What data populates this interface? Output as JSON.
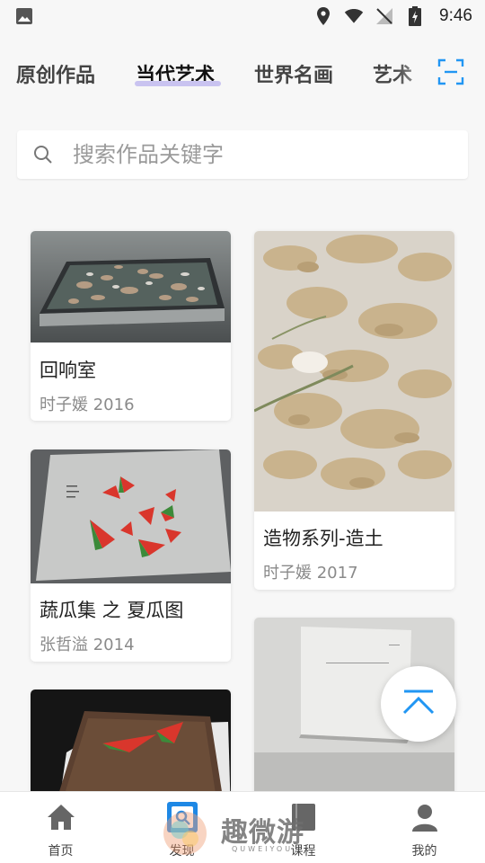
{
  "status_bar": {
    "time": "9:46"
  },
  "tabs": [
    {
      "label": "原创作品"
    },
    {
      "label": "当代艺术",
      "active": true
    },
    {
      "label": "世界名画"
    },
    {
      "label": "艺术"
    }
  ],
  "search": {
    "placeholder": "搜索作品关键字"
  },
  "cards": [
    {
      "title": "回响室",
      "subtitle": "时子媛 2016"
    },
    {
      "title": "造物系列-造土",
      "subtitle": "时子媛 2017"
    },
    {
      "title": "蔬瓜集 之 夏瓜图",
      "subtitle": "张哲溢 2014"
    },
    {
      "title": "",
      "subtitle": ""
    },
    {
      "title": "",
      "subtitle": ""
    }
  ],
  "bottom_nav": [
    {
      "label": "首页",
      "icon": "home-icon"
    },
    {
      "label": "发现",
      "icon": "discover-icon",
      "active": true
    },
    {
      "label": "课程",
      "icon": "book-icon"
    },
    {
      "label": "我的",
      "icon": "profile-icon"
    }
  ],
  "watermark": {
    "text": "趣微游",
    "sub": "QUWEIYOU"
  },
  "colors": {
    "accent": "#2196f3",
    "tab_underline": "#c9c3f0",
    "watermelon": "#d9362c"
  }
}
